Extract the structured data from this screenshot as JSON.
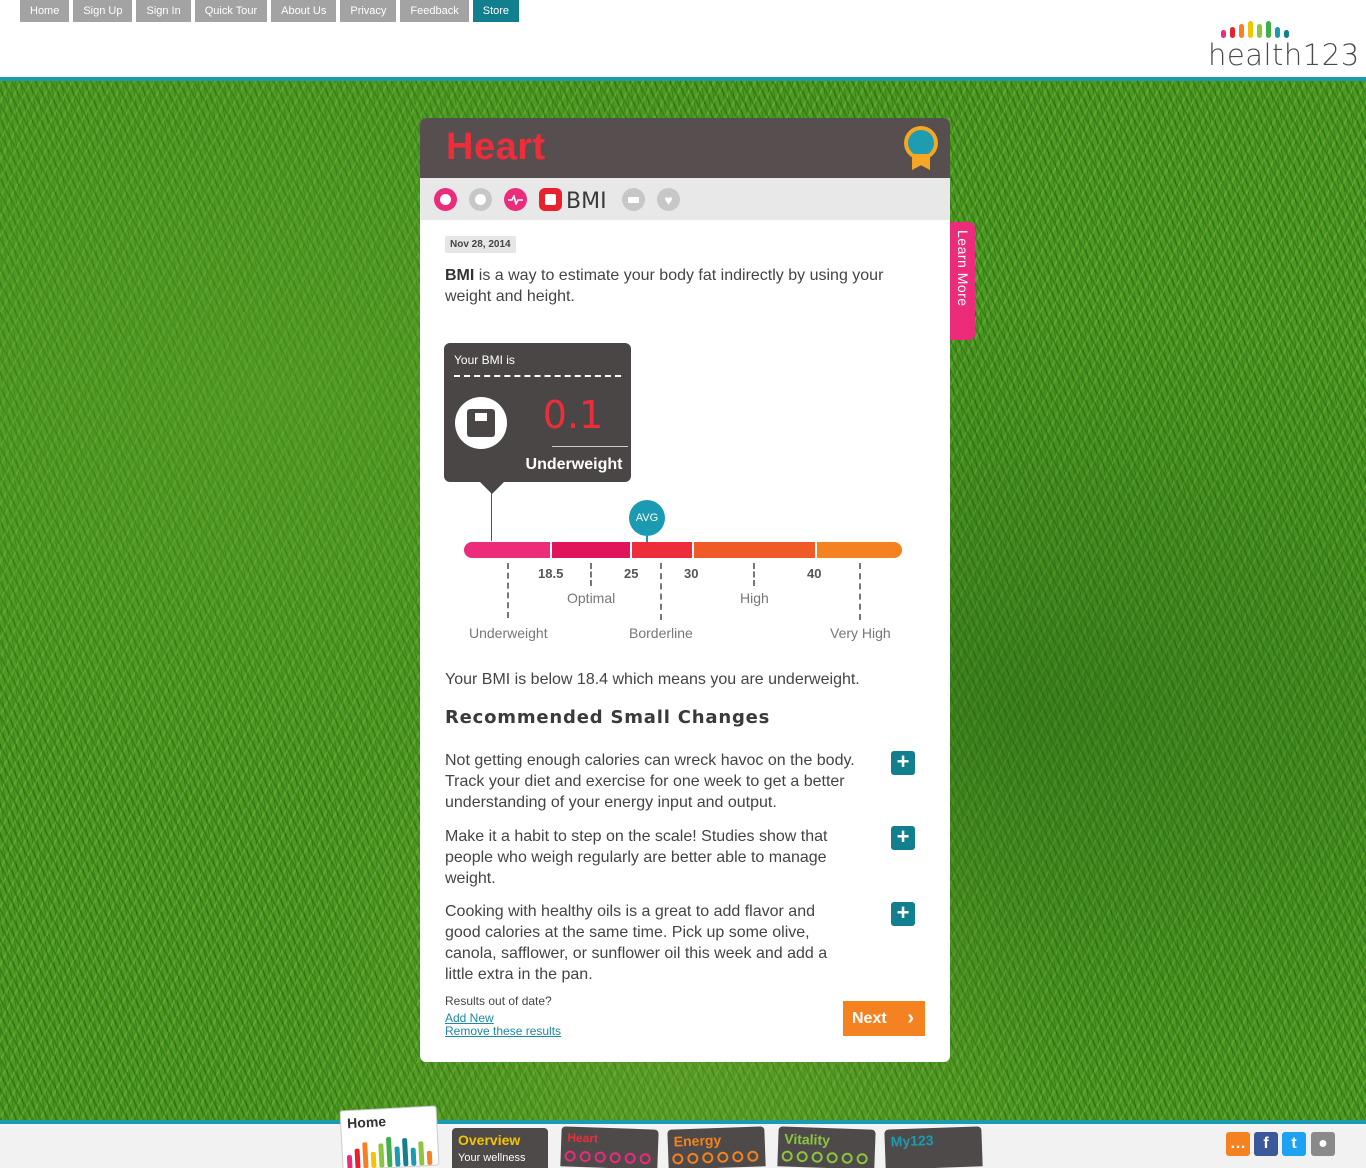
{
  "nav": [
    "Home",
    "Sign Up",
    "Sign In",
    "Quick Tour",
    "About Us",
    "Privacy",
    "Feedback",
    "Store"
  ],
  "logo": {
    "text": "health123"
  },
  "card": {
    "title": "Heart",
    "tab_label": "BMI",
    "date": "Nov 28, 2014",
    "intro_term": "BMI",
    "intro_rest": " is a way to estimate your body fat indirectly by using your weight and height.",
    "bmi_label": "Your BMI is",
    "bmi_value": "0.1",
    "bmi_category": "Underweight",
    "avg_label": "AVG",
    "scale": {
      "ticks": [
        "18.5",
        "25",
        "30",
        "40"
      ],
      "ranges": [
        "Underweight",
        "Optimal",
        "Borderline",
        "High",
        "Very High"
      ]
    },
    "summary": "Your BMI is below 18.4 which means you are underweight.",
    "rec_title": "Recommended Small Changes",
    "tips": [
      "Not getting enough calories can wreck havoc on the body. Track your diet and exercise for one week to get a better understanding of your energy input and output.",
      "Make it a habit to step on the scale! Studies show that people who weigh regularly are better able to manage weight.",
      "Cooking with healthy oils is a great to add flavor and good calories at the same time. Pick up some olive, canola, safflower, or sunflower oil this week and add a little extra in the pan."
    ],
    "out_of_date": "Results out of date?",
    "add_new": "Add New",
    "remove": "Remove these results",
    "next": "Next"
  },
  "learn_more": "Learn More",
  "bottom_tabs": {
    "home": "Home",
    "overview": "Overview",
    "overview_sub": "Your wellness",
    "heart": "Heart",
    "energy": "Energy",
    "vitality": "Vitality",
    "my123": "My123"
  },
  "colors": {
    "accent_teal": "#1b9bb1",
    "heart_red": "#ee2d3a",
    "learn_pink": "#ec2b7a",
    "next_orange": "#f58220"
  }
}
